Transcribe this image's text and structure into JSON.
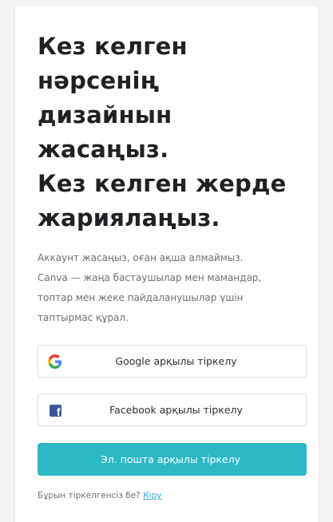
{
  "headline": {
    "lines": [
      "Кез келген",
      "нәрсенің",
      "дизайнын",
      "жасаңыз.",
      "Кез келген жерде",
      "жариялаңыз."
    ]
  },
  "description": {
    "lines": [
      "Аккаунт жасаңыз, оған ақша алмаймыз.",
      "Canva — жаңа бастаушылар мен мамандар,",
      "топтар мен жеке пайдаланушылар үшін",
      "таптырмас құрал."
    ]
  },
  "buttons": {
    "google": {
      "label": "Google арқылы тіркелу",
      "icon": "google-icon"
    },
    "facebook": {
      "label": "Facebook арқылы тіркелу",
      "icon": "facebook-icon"
    },
    "email": {
      "label": "Эл. пошта арқылы тіркелу"
    }
  },
  "footer": {
    "prompt": "Бұрын тіркелгенсіз бе?",
    "link": "Кіру"
  },
  "colors": {
    "primary": "#2bb8c7",
    "link": "#2fa8d8",
    "heading": "#202124",
    "body_text": "#6b7075",
    "facebook_blue": "#3b5998"
  }
}
